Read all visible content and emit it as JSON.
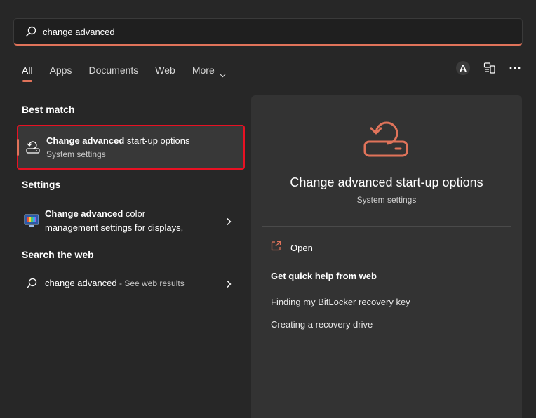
{
  "search": {
    "query": "change advanced"
  },
  "tabs": [
    {
      "label": "All"
    },
    {
      "label": "Apps"
    },
    {
      "label": "Documents"
    },
    {
      "label": "Web"
    },
    {
      "label": "More"
    }
  ],
  "user": {
    "avatar_letter": "A"
  },
  "icons": {
    "search": "search-icon",
    "startup": "restart-drive-icon",
    "display": "monitor-color-icon",
    "chevron": "chevron-right-icon",
    "open": "open-external-icon",
    "share": "connected-devices-icon",
    "more": "more-options-icon"
  },
  "colors": {
    "accent": "#e0735a",
    "highlight_border": "#e81123",
    "background": "#272727",
    "panel": "#333333"
  },
  "sections": {
    "best_match": "Best match",
    "settings": "Settings",
    "search_web": "Search the web"
  },
  "best_match": {
    "title_bold": "Change advanced",
    "title_rest": " start-up options",
    "subtitle": "System settings"
  },
  "settings_result": {
    "title_bold": "Change advanced",
    "title_rest": " color",
    "line2": "management settings for displays,"
  },
  "web_result": {
    "query": "change advanced",
    "suffix": " - See web results"
  },
  "detail": {
    "title": "Change advanced start-up options",
    "subtitle": "System settings",
    "open_label": "Open",
    "help_title": "Get quick help from web",
    "links": [
      "Finding my BitLocker recovery key",
      "Creating a recovery drive"
    ]
  }
}
